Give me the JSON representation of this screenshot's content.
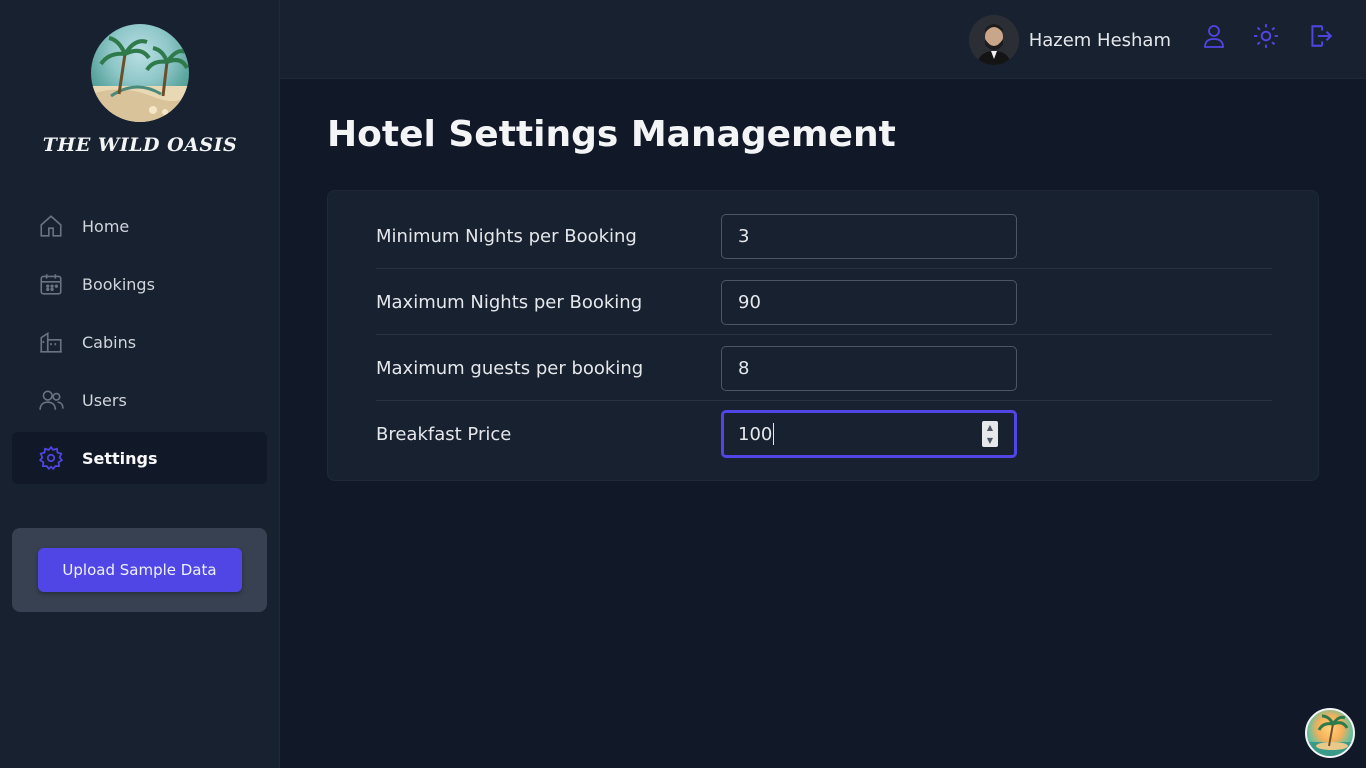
{
  "brand": {
    "name": "THE WILD OASIS",
    "logo_icon": "palm-island-logo"
  },
  "sidebar": {
    "items": [
      {
        "label": "Home",
        "icon": "home-icon"
      },
      {
        "label": "Bookings",
        "icon": "calendar-icon"
      },
      {
        "label": "Cabins",
        "icon": "building-icon"
      },
      {
        "label": "Users",
        "icon": "users-icon"
      },
      {
        "label": "Settings",
        "icon": "gear-icon",
        "active": true
      }
    ],
    "upload_label": "Upload Sample Data"
  },
  "header": {
    "user_name": "Hazem Hesham",
    "icons": [
      "user-icon",
      "sun-icon",
      "logout-icon"
    ],
    "accent": "#4f46e5"
  },
  "main": {
    "title": "Hotel Settings Management",
    "settings": [
      {
        "label": "Minimum Nights per Booking",
        "value": "3"
      },
      {
        "label": "Maximum Nights per Booking",
        "value": "90"
      },
      {
        "label": "Maximum guests per booking",
        "value": "8"
      },
      {
        "label": "Breakfast Price",
        "value": "100",
        "focused": true
      }
    ]
  }
}
